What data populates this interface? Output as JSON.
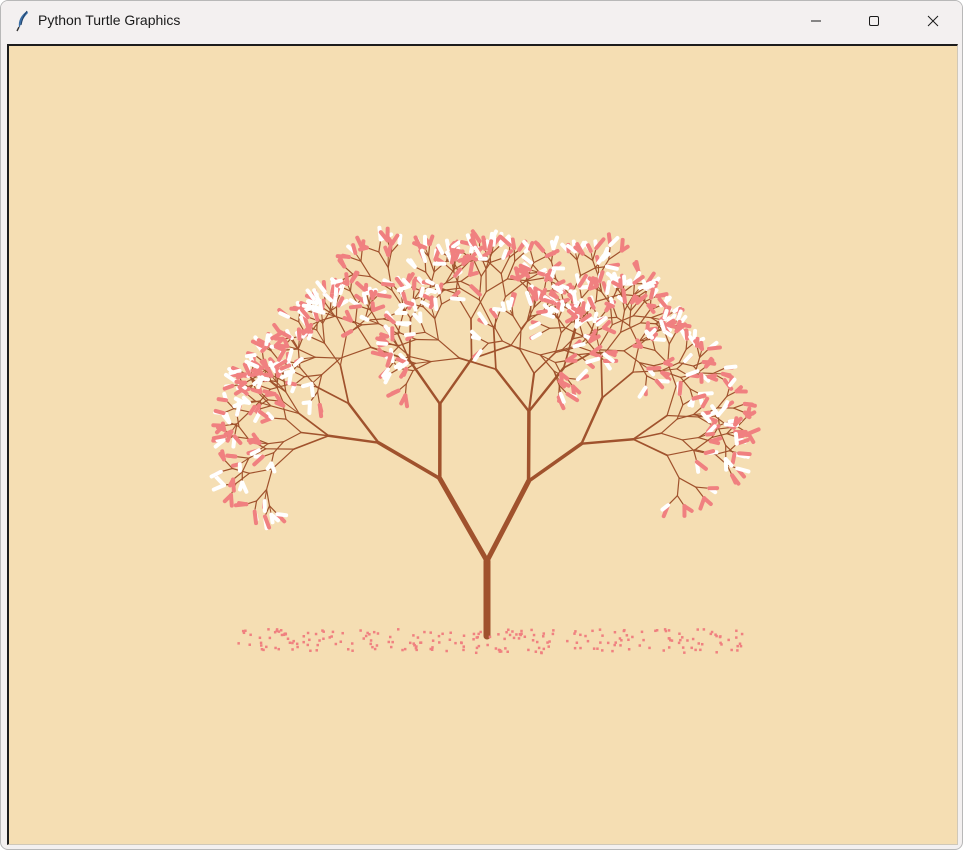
{
  "window": {
    "title": "Python Turtle Graphics",
    "icon": "feather-icon",
    "controls": [
      "minimize-icon",
      "maximize-icon",
      "close-icon"
    ]
  },
  "canvas": {
    "background": "#f5deb3",
    "trunk_color": "#a0522d",
    "blossom_pink": "#f08080",
    "blossom_white": "#ffffff",
    "petal_color": "#f08080"
  }
}
